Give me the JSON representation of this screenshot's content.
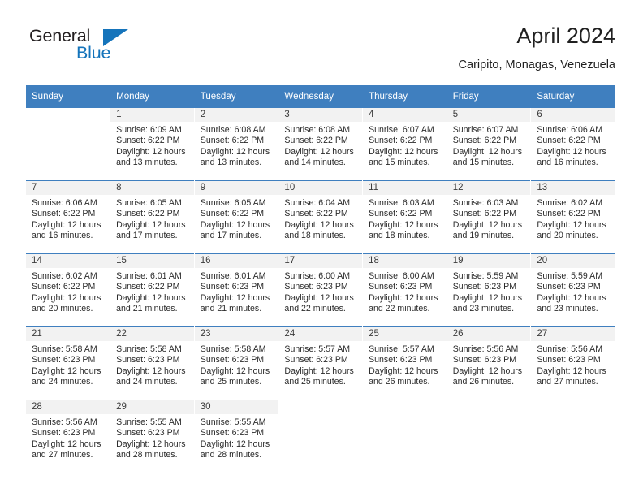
{
  "brand": {
    "name_part1": "General",
    "name_part2": "Blue",
    "triangle_color": "#1574bb"
  },
  "header": {
    "title": "April 2024",
    "subtitle": "Caripito, Monagas, Venezuela",
    "header_bg_color": "#3f7fbf"
  },
  "weekdays": [
    "Sunday",
    "Monday",
    "Tuesday",
    "Wednesday",
    "Thursday",
    "Friday",
    "Saturday"
  ],
  "labels": {
    "sunrise": "Sunrise:",
    "sunset": "Sunset:",
    "daylight": "Daylight:"
  },
  "weeks": [
    [
      {
        "day": "",
        "sunrise": "",
        "sunset": "",
        "daylight_line1": "",
        "daylight_line2": "",
        "blank": true
      },
      {
        "day": "1",
        "sunrise": "Sunrise: 6:09 AM",
        "sunset": "Sunset: 6:22 PM",
        "daylight_line1": "Daylight: 12 hours",
        "daylight_line2": "and 13 minutes.",
        "blank": false
      },
      {
        "day": "2",
        "sunrise": "Sunrise: 6:08 AM",
        "sunset": "Sunset: 6:22 PM",
        "daylight_line1": "Daylight: 12 hours",
        "daylight_line2": "and 13 minutes.",
        "blank": false
      },
      {
        "day": "3",
        "sunrise": "Sunrise: 6:08 AM",
        "sunset": "Sunset: 6:22 PM",
        "daylight_line1": "Daylight: 12 hours",
        "daylight_line2": "and 14 minutes.",
        "blank": false
      },
      {
        "day": "4",
        "sunrise": "Sunrise: 6:07 AM",
        "sunset": "Sunset: 6:22 PM",
        "daylight_line1": "Daylight: 12 hours",
        "daylight_line2": "and 15 minutes.",
        "blank": false
      },
      {
        "day": "5",
        "sunrise": "Sunrise: 6:07 AM",
        "sunset": "Sunset: 6:22 PM",
        "daylight_line1": "Daylight: 12 hours",
        "daylight_line2": "and 15 minutes.",
        "blank": false
      },
      {
        "day": "6",
        "sunrise": "Sunrise: 6:06 AM",
        "sunset": "Sunset: 6:22 PM",
        "daylight_line1": "Daylight: 12 hours",
        "daylight_line2": "and 16 minutes.",
        "blank": false
      }
    ],
    [
      {
        "day": "7",
        "sunrise": "Sunrise: 6:06 AM",
        "sunset": "Sunset: 6:22 PM",
        "daylight_line1": "Daylight: 12 hours",
        "daylight_line2": "and 16 minutes.",
        "blank": false
      },
      {
        "day": "8",
        "sunrise": "Sunrise: 6:05 AM",
        "sunset": "Sunset: 6:22 PM",
        "daylight_line1": "Daylight: 12 hours",
        "daylight_line2": "and 17 minutes.",
        "blank": false
      },
      {
        "day": "9",
        "sunrise": "Sunrise: 6:05 AM",
        "sunset": "Sunset: 6:22 PM",
        "daylight_line1": "Daylight: 12 hours",
        "daylight_line2": "and 17 minutes.",
        "blank": false
      },
      {
        "day": "10",
        "sunrise": "Sunrise: 6:04 AM",
        "sunset": "Sunset: 6:22 PM",
        "daylight_line1": "Daylight: 12 hours",
        "daylight_line2": "and 18 minutes.",
        "blank": false
      },
      {
        "day": "11",
        "sunrise": "Sunrise: 6:03 AM",
        "sunset": "Sunset: 6:22 PM",
        "daylight_line1": "Daylight: 12 hours",
        "daylight_line2": "and 18 minutes.",
        "blank": false
      },
      {
        "day": "12",
        "sunrise": "Sunrise: 6:03 AM",
        "sunset": "Sunset: 6:22 PM",
        "daylight_line1": "Daylight: 12 hours",
        "daylight_line2": "and 19 minutes.",
        "blank": false
      },
      {
        "day": "13",
        "sunrise": "Sunrise: 6:02 AM",
        "sunset": "Sunset: 6:22 PM",
        "daylight_line1": "Daylight: 12 hours",
        "daylight_line2": "and 20 minutes.",
        "blank": false
      }
    ],
    [
      {
        "day": "14",
        "sunrise": "Sunrise: 6:02 AM",
        "sunset": "Sunset: 6:22 PM",
        "daylight_line1": "Daylight: 12 hours",
        "daylight_line2": "and 20 minutes.",
        "blank": false
      },
      {
        "day": "15",
        "sunrise": "Sunrise: 6:01 AM",
        "sunset": "Sunset: 6:22 PM",
        "daylight_line1": "Daylight: 12 hours",
        "daylight_line2": "and 21 minutes.",
        "blank": false
      },
      {
        "day": "16",
        "sunrise": "Sunrise: 6:01 AM",
        "sunset": "Sunset: 6:23 PM",
        "daylight_line1": "Daylight: 12 hours",
        "daylight_line2": "and 21 minutes.",
        "blank": false
      },
      {
        "day": "17",
        "sunrise": "Sunrise: 6:00 AM",
        "sunset": "Sunset: 6:23 PM",
        "daylight_line1": "Daylight: 12 hours",
        "daylight_line2": "and 22 minutes.",
        "blank": false
      },
      {
        "day": "18",
        "sunrise": "Sunrise: 6:00 AM",
        "sunset": "Sunset: 6:23 PM",
        "daylight_line1": "Daylight: 12 hours",
        "daylight_line2": "and 22 minutes.",
        "blank": false
      },
      {
        "day": "19",
        "sunrise": "Sunrise: 5:59 AM",
        "sunset": "Sunset: 6:23 PM",
        "daylight_line1": "Daylight: 12 hours",
        "daylight_line2": "and 23 minutes.",
        "blank": false
      },
      {
        "day": "20",
        "sunrise": "Sunrise: 5:59 AM",
        "sunset": "Sunset: 6:23 PM",
        "daylight_line1": "Daylight: 12 hours",
        "daylight_line2": "and 23 minutes.",
        "blank": false
      }
    ],
    [
      {
        "day": "21",
        "sunrise": "Sunrise: 5:58 AM",
        "sunset": "Sunset: 6:23 PM",
        "daylight_line1": "Daylight: 12 hours",
        "daylight_line2": "and 24 minutes.",
        "blank": false
      },
      {
        "day": "22",
        "sunrise": "Sunrise: 5:58 AM",
        "sunset": "Sunset: 6:23 PM",
        "daylight_line1": "Daylight: 12 hours",
        "daylight_line2": "and 24 minutes.",
        "blank": false
      },
      {
        "day": "23",
        "sunrise": "Sunrise: 5:58 AM",
        "sunset": "Sunset: 6:23 PM",
        "daylight_line1": "Daylight: 12 hours",
        "daylight_line2": "and 25 minutes.",
        "blank": false
      },
      {
        "day": "24",
        "sunrise": "Sunrise: 5:57 AM",
        "sunset": "Sunset: 6:23 PM",
        "daylight_line1": "Daylight: 12 hours",
        "daylight_line2": "and 25 minutes.",
        "blank": false
      },
      {
        "day": "25",
        "sunrise": "Sunrise: 5:57 AM",
        "sunset": "Sunset: 6:23 PM",
        "daylight_line1": "Daylight: 12 hours",
        "daylight_line2": "and 26 minutes.",
        "blank": false
      },
      {
        "day": "26",
        "sunrise": "Sunrise: 5:56 AM",
        "sunset": "Sunset: 6:23 PM",
        "daylight_line1": "Daylight: 12 hours",
        "daylight_line2": "and 26 minutes.",
        "blank": false
      },
      {
        "day": "27",
        "sunrise": "Sunrise: 5:56 AM",
        "sunset": "Sunset: 6:23 PM",
        "daylight_line1": "Daylight: 12 hours",
        "daylight_line2": "and 27 minutes.",
        "blank": false
      }
    ],
    [
      {
        "day": "28",
        "sunrise": "Sunrise: 5:56 AM",
        "sunset": "Sunset: 6:23 PM",
        "daylight_line1": "Daylight: 12 hours",
        "daylight_line2": "and 27 minutes.",
        "blank": false
      },
      {
        "day": "29",
        "sunrise": "Sunrise: 5:55 AM",
        "sunset": "Sunset: 6:23 PM",
        "daylight_line1": "Daylight: 12 hours",
        "daylight_line2": "and 28 minutes.",
        "blank": false
      },
      {
        "day": "30",
        "sunrise": "Sunrise: 5:55 AM",
        "sunset": "Sunset: 6:23 PM",
        "daylight_line1": "Daylight: 12 hours",
        "daylight_line2": "and 28 minutes.",
        "blank": false
      },
      {
        "day": "",
        "sunrise": "",
        "sunset": "",
        "daylight_line1": "",
        "daylight_line2": "",
        "blank": true
      },
      {
        "day": "",
        "sunrise": "",
        "sunset": "",
        "daylight_line1": "",
        "daylight_line2": "",
        "blank": true
      },
      {
        "day": "",
        "sunrise": "",
        "sunset": "",
        "daylight_line1": "",
        "daylight_line2": "",
        "blank": true
      },
      {
        "day": "",
        "sunrise": "",
        "sunset": "",
        "daylight_line1": "",
        "daylight_line2": "",
        "blank": true
      }
    ]
  ]
}
